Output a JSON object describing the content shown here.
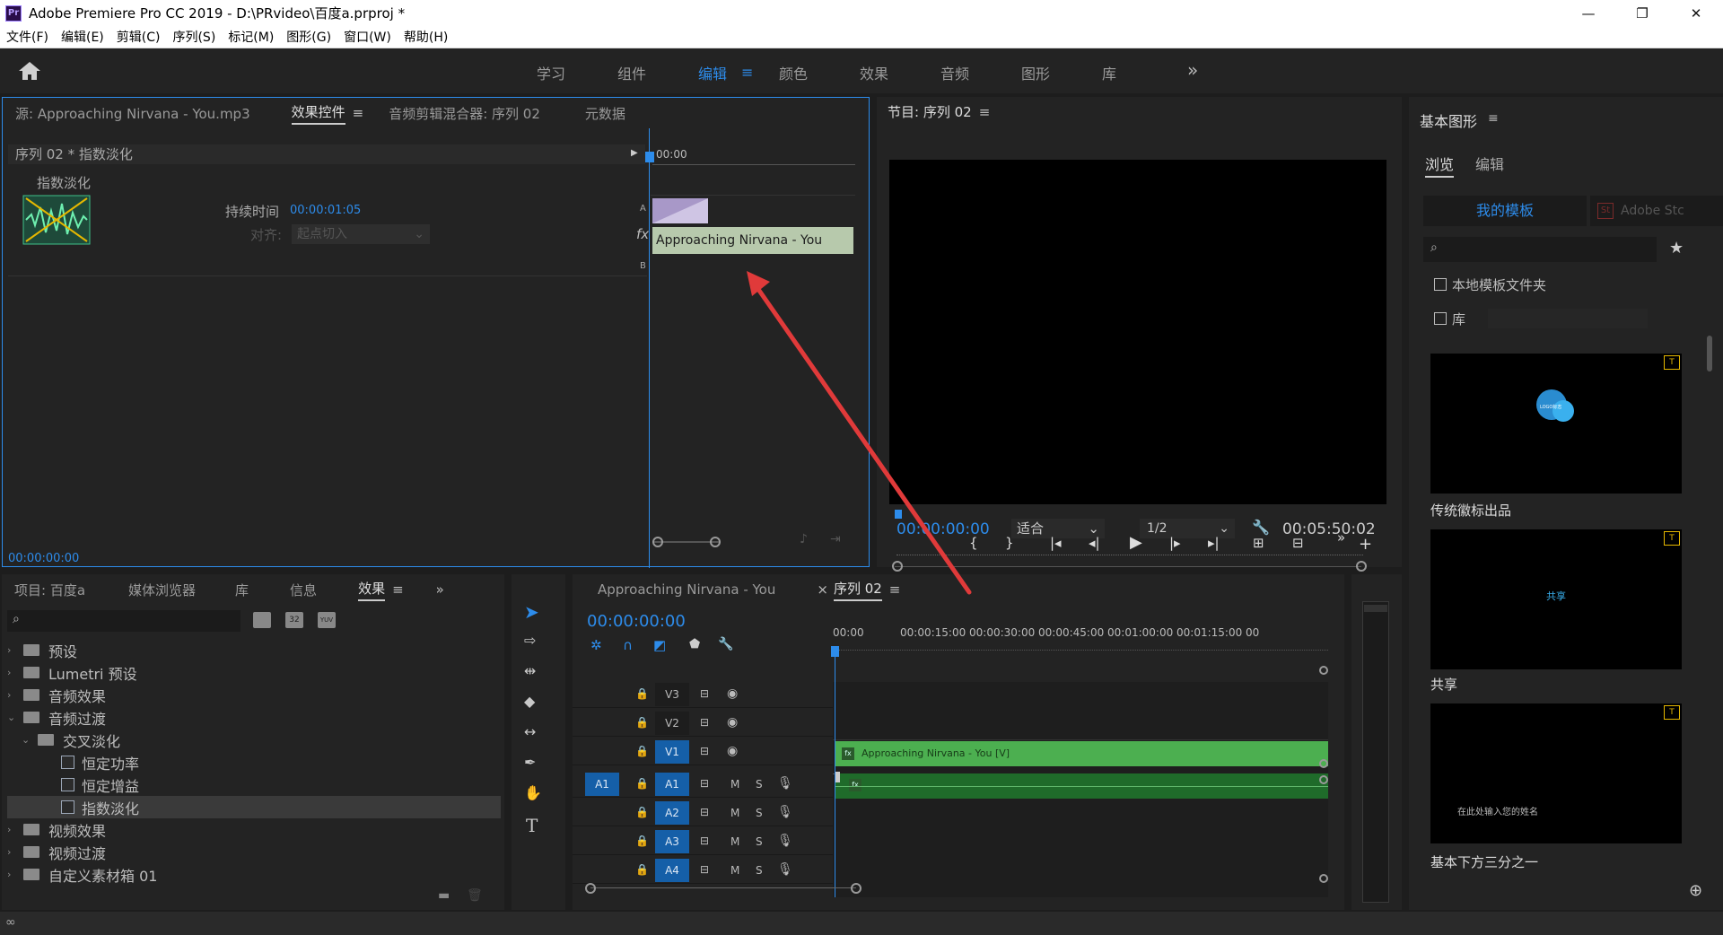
{
  "window": {
    "title": "Adobe Premiere Pro CC 2019 - D:\\PRvideo\\百度a.prproj *",
    "app_icon": "Pr",
    "buttons": [
      "minimize",
      "restore",
      "close"
    ]
  },
  "menu": [
    "文件(F)",
    "编辑(E)",
    "剪辑(C)",
    "序列(S)",
    "标记(M)",
    "图形(G)",
    "窗口(W)",
    "帮助(H)"
  ],
  "workspaces": {
    "tabs": [
      "学习",
      "组件",
      "编辑",
      "颜色",
      "效果",
      "音频",
      "图形",
      "库"
    ],
    "active": "编辑",
    "more": "»"
  },
  "effect_controls": {
    "tabs": [
      "源: Approaching Nirvana - You.mp3",
      "效果控件",
      "音频剪辑混合器: 序列 02",
      "元数据"
    ],
    "active_tab": "效果控件",
    "clip_header": "序列 02 * 指数淡化",
    "effect_name": "指数淡化",
    "duration_label": "持续时间",
    "duration_value": "00:00:01:05",
    "align_label": "对齐:",
    "align_value": "起点切入",
    "ruler_time": "00:00",
    "track_a": "A",
    "track_b": "B",
    "fx": "fx",
    "clip_name": "Approaching Nirvana - You",
    "timecode": "00:00:00:00"
  },
  "program_monitor": {
    "title": "节目: 序列 02",
    "timecode": "00:00:00:00",
    "fit_value": "适合",
    "resolution": "1/2",
    "duration": "00:05:50:02"
  },
  "essential_graphics": {
    "title": "基本图形",
    "tabs": [
      "浏览",
      "编辑"
    ],
    "active_tab": "浏览",
    "source_tabs": [
      "我的模板",
      "Adobe Stc"
    ],
    "search_placeholder": "",
    "local_folder_label": "本地模板文件夹",
    "library_label": "库",
    "templates": [
      {
        "name": "传统徽标出品",
        "thumb_text": "LOGO标志"
      },
      {
        "name": "共享",
        "thumb_text": "共享"
      },
      {
        "name": "基本下方三分之一",
        "thumb_text": "在此处输入您的姓名"
      }
    ]
  },
  "project_panel": {
    "tabs": [
      "项目: 百度a",
      "媒体浏览器",
      "库",
      "信息",
      "效果"
    ],
    "active_tab": "效果",
    "icon_badges": [
      "32",
      "YUV"
    ],
    "tree": [
      {
        "label": "预设",
        "level": 0,
        "kind": "folder",
        "expanded": false
      },
      {
        "label": "Lumetri 预设",
        "level": 0,
        "kind": "folder",
        "expanded": false
      },
      {
        "label": "音频效果",
        "level": 0,
        "kind": "folder",
        "expanded": false
      },
      {
        "label": "音频过渡",
        "level": 0,
        "kind": "folder",
        "expanded": true
      },
      {
        "label": "交叉淡化",
        "level": 1,
        "kind": "folder",
        "expanded": true
      },
      {
        "label": "恒定功率",
        "level": 2,
        "kind": "effect"
      },
      {
        "label": "恒定增益",
        "level": 2,
        "kind": "effect"
      },
      {
        "label": "指数淡化",
        "level": 2,
        "kind": "effect",
        "selected": true
      },
      {
        "label": "视频效果",
        "level": 0,
        "kind": "folder",
        "expanded": false
      },
      {
        "label": "视频过渡",
        "level": 0,
        "kind": "folder",
        "expanded": false
      },
      {
        "label": "自定义素材箱 01",
        "level": 0,
        "kind": "folder",
        "expanded": false
      }
    ]
  },
  "timeline": {
    "tabs": [
      "Approaching Nirvana - You",
      "序列 02"
    ],
    "active_tab": "序列 02",
    "close_glyph": "×",
    "timecode": "00:00:00:00",
    "ruler": [
      "00:00",
      "00:00:15:00",
      "00:00:30:00",
      "00:00:45:00",
      "00:01:00:00",
      "00:01:15:00",
      "00"
    ],
    "video_tracks": [
      "V3",
      "V2",
      "V1"
    ],
    "audio_tracks": [
      "A1",
      "A2",
      "A3",
      "A4"
    ],
    "source_patch": "A1",
    "mute": "M",
    "solo": "S",
    "video_clip": "Approaching Nirvana - You [V]",
    "clip_fx": "fx",
    "tools": [
      "selection",
      "track-select",
      "ripple-edit",
      "razor",
      "slip",
      "pen",
      "hand",
      "type"
    ]
  },
  "colors": {
    "accent": "#2d8ceb",
    "video_clip": "#4caf50",
    "audio_clip": "#1f6b2a",
    "transition": "#a898c8",
    "arrow": "#e03a3a"
  }
}
